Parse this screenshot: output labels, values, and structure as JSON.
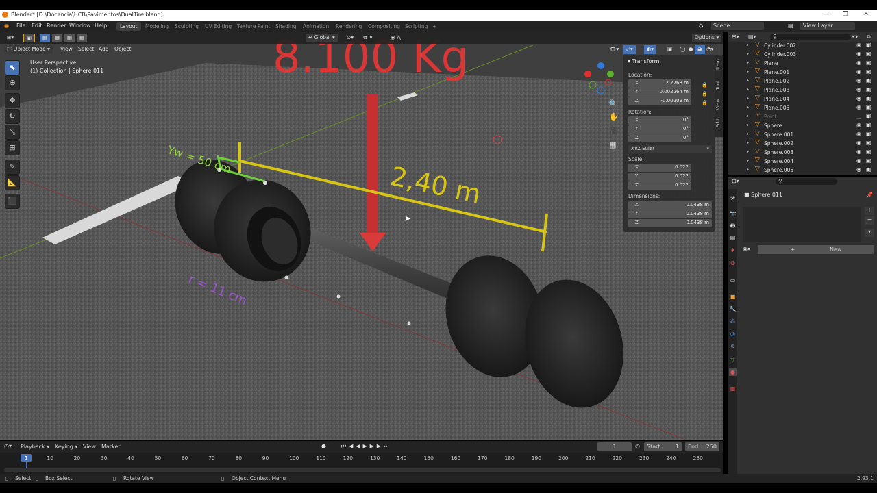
{
  "window": {
    "title": "Blender* [D:\\Docencia\\UCB\\Pavimentos\\DualTire.blend]"
  },
  "menus": [
    "File",
    "Edit",
    "Render",
    "Window",
    "Help"
  ],
  "workspaces": [
    "Layout",
    "Modeling",
    "Sculpting",
    "UV Editing",
    "Texture Paint",
    "Shading",
    "Animation",
    "Rendering",
    "Compositing",
    "Scripting"
  ],
  "scene": {
    "name": "Scene",
    "view_layer": "View Layer"
  },
  "header": {
    "mode": "Object Mode",
    "view": "View",
    "select": "Select",
    "add": "Add",
    "object": "Object",
    "orientation": "Global",
    "options": "Options"
  },
  "viewport": {
    "perspective": "User Perspective",
    "collection": "(1) Collection | Sphere.011",
    "annot_weight": "8.100 Kg",
    "annot_width": "Yw = 50 cm",
    "annot_length": "2,40 m",
    "annot_radius": "r = 11 cm"
  },
  "npanel": {
    "title": "Transform",
    "location_label": "Location:",
    "rotation_label": "Rotation:",
    "scale_label": "Scale:",
    "dimensions_label": "Dimensions:",
    "loc": [
      "2.2768 m",
      "0.002264 m",
      "-0.00209 m"
    ],
    "rot": [
      "0°",
      "0°",
      "0°"
    ],
    "rot_mode": "XYZ Euler",
    "scale": [
      "0.022",
      "0.022",
      "0.022"
    ],
    "dim": [
      "0.0438 m",
      "0.0438 m",
      "0.0438 m"
    ],
    "tabs": [
      "Item",
      "Tool",
      "View",
      "Edit"
    ]
  },
  "axes": [
    "X",
    "Y",
    "Z"
  ],
  "outliner": {
    "items": [
      "Cylinder.002",
      "Cylinder.003",
      "Plane",
      "Plane.001",
      "Plane.002",
      "Plane.003",
      "Plane.004",
      "Plane.005",
      "Point",
      "Sphere",
      "Sphere.001",
      "Sphere.002",
      "Sphere.003",
      "Sphere.004",
      "Sphere.005"
    ]
  },
  "properties": {
    "object_name": "Sphere.011",
    "new_label": "New"
  },
  "timeline": {
    "playback": "Playback",
    "keying": "Keying",
    "view": "View",
    "marker": "Marker",
    "current": "1",
    "start_label": "Start",
    "start": "1",
    "end_label": "End",
    "end": "250",
    "ticks": [
      "1",
      "10",
      "20",
      "30",
      "40",
      "50",
      "60",
      "70",
      "80",
      "90",
      "100",
      "110",
      "120",
      "130",
      "140",
      "150",
      "160",
      "170",
      "180",
      "190",
      "200",
      "210",
      "220",
      "230",
      "240",
      "250"
    ]
  },
  "statusbar": {
    "select": "Select",
    "box": "Box Select",
    "rotate": "Rotate View",
    "context": "Object Context Menu",
    "version": "2.93.1"
  },
  "colors": {
    "accent": "#4772b3",
    "weight": "#d93636",
    "dim": "#d6c417",
    "green": "#6fcf3a",
    "radius": "#9955cc"
  }
}
